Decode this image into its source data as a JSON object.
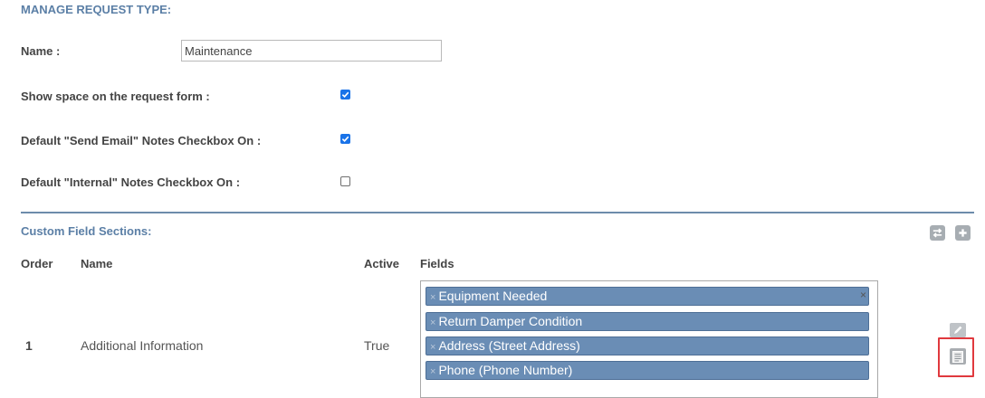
{
  "header": {
    "title": "MANAGE REQUEST TYPE:"
  },
  "form": {
    "name_label": "Name :",
    "name_value": "Maintenance",
    "show_space_label": "Show space on the request form :",
    "show_space_checked": true,
    "send_email_label": "Default \"Send Email\" Notes Checkbox On :",
    "send_email_checked": true,
    "internal_label": "Default \"Internal\" Notes Checkbox On :",
    "internal_checked": false
  },
  "custom_fields": {
    "title": "Custom Field Sections:",
    "reorder_icon": "swap-arrows-icon",
    "add_icon": "plus-icon",
    "columns": {
      "order": "Order",
      "name": "Name",
      "active": "Active",
      "fields": "Fields"
    },
    "rows": [
      {
        "order": "1",
        "name": "Additional Information",
        "active": "True",
        "fields": [
          "Equipment Needed",
          "Return Damper Condition",
          "Address (Street Address)",
          "Phone (Phone Number)"
        ],
        "remove_tag_glyph": "×",
        "clear_glyph": "×",
        "edit_icon": "pencil-icon",
        "details_icon": "list-details-icon"
      }
    ]
  },
  "colors": {
    "accent": "#5b7fa6",
    "tag_bg": "#6a8db5",
    "highlight": "#e0393e",
    "checkbox": "#1a73e8"
  }
}
